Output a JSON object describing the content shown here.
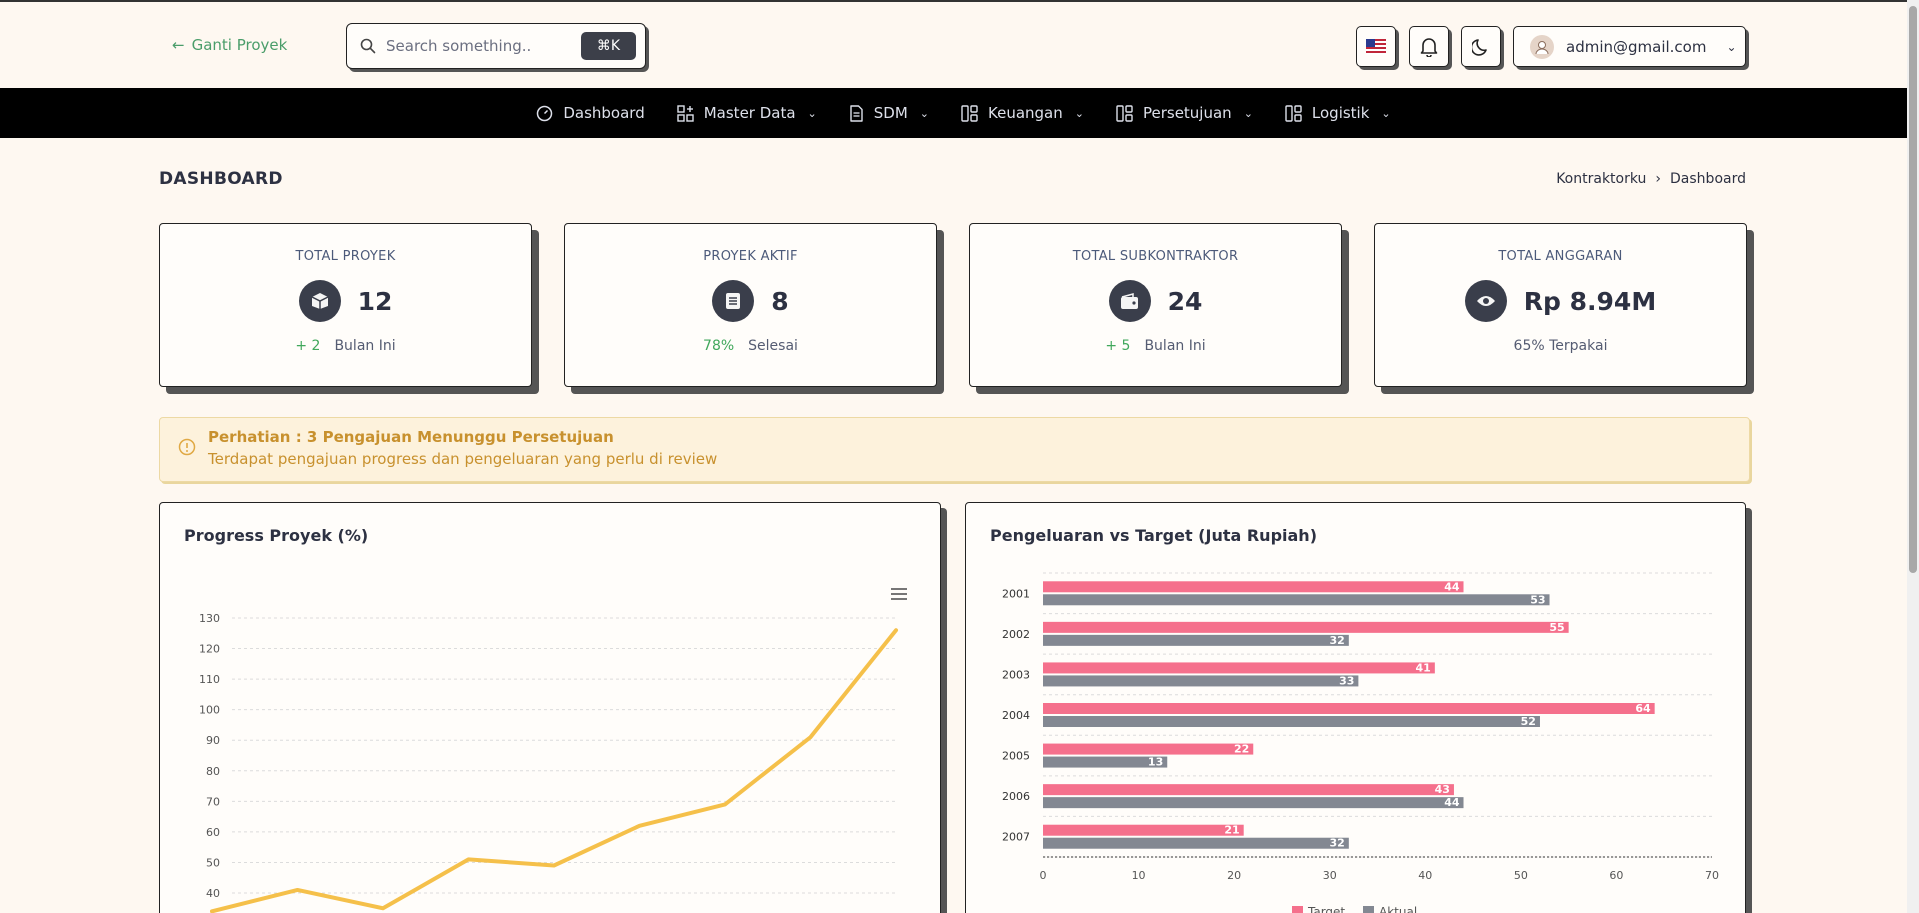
{
  "topbar": {
    "back_label": "Ganti Proyek",
    "search_placeholder": "Search something..",
    "search_shortcut": "⌘K",
    "user_email": "admin@gmail.com"
  },
  "nav": {
    "items": [
      {
        "label": "Dashboard",
        "icon": "gauge-icon"
      },
      {
        "label": "Master Data",
        "icon": "grid-plus-icon"
      },
      {
        "label": "SDM",
        "icon": "document-icon"
      },
      {
        "label": "Keuangan",
        "icon": "columns-icon"
      },
      {
        "label": "Persetujuan",
        "icon": "columns-icon"
      },
      {
        "label": "Logistik",
        "icon": "columns-icon"
      }
    ]
  },
  "page": {
    "title": "DASHBOARD",
    "breadcrumb": [
      "Kontraktorku",
      "Dashboard"
    ]
  },
  "stats": [
    {
      "label": "TOTAL PROYEK",
      "value": "12",
      "delta": "+ 2",
      "foot": "Bulan Ini",
      "icon": "box-icon"
    },
    {
      "label": "PROYEK AKTIF",
      "value": "8",
      "delta": "78%",
      "foot": "Selesai",
      "icon": "list-icon"
    },
    {
      "label": "TOTAL SUBKONTRAKTOR",
      "value": "24",
      "delta": "+ 5",
      "foot": "Bulan Ini",
      "icon": "wallet-icon"
    },
    {
      "label": "TOTAL ANGGARAN",
      "value": "Rp 8.94M",
      "delta": "",
      "foot": "65% Terpakai",
      "icon": "eye-icon"
    }
  ],
  "alert": {
    "title": "Perhatian : 3 Pengajuan Menunggu Persetujuan",
    "text": "Terdapat pengajuan progress dan pengeluaran yang perlu di review"
  },
  "colors": {
    "line": "#f5c04a",
    "target": "#f5708c",
    "aktual": "#838892",
    "nav_bg": "#000000",
    "page_bg": "#fef8f1"
  },
  "chart_data": [
    {
      "type": "line",
      "title": "Progress Proyek (%)",
      "yticks": [
        40,
        50,
        60,
        70,
        80,
        90,
        100,
        110,
        120,
        130
      ],
      "ylim": [
        40,
        130
      ],
      "series": [
        {
          "values": [
            34,
            41,
            35,
            51,
            49,
            62,
            69,
            91,
            126
          ]
        }
      ],
      "grid": true
    },
    {
      "type": "bar",
      "orientation": "horizontal",
      "title": "Pengeluaran vs Target (Juta Rupiah)",
      "categories": [
        "2001",
        "2002",
        "2003",
        "2004",
        "2005",
        "2006",
        "2007"
      ],
      "xticks": [
        0,
        10,
        20,
        30,
        40,
        50,
        60,
        70
      ],
      "xlim": [
        0,
        70
      ],
      "series": [
        {
          "name": "Target",
          "values": [
            44,
            55,
            41,
            64,
            22,
            43,
            21
          ]
        },
        {
          "name": "Aktual",
          "values": [
            53,
            32,
            33,
            52,
            13,
            44,
            32
          ]
        }
      ],
      "legend": "bottom",
      "grid": true
    }
  ]
}
